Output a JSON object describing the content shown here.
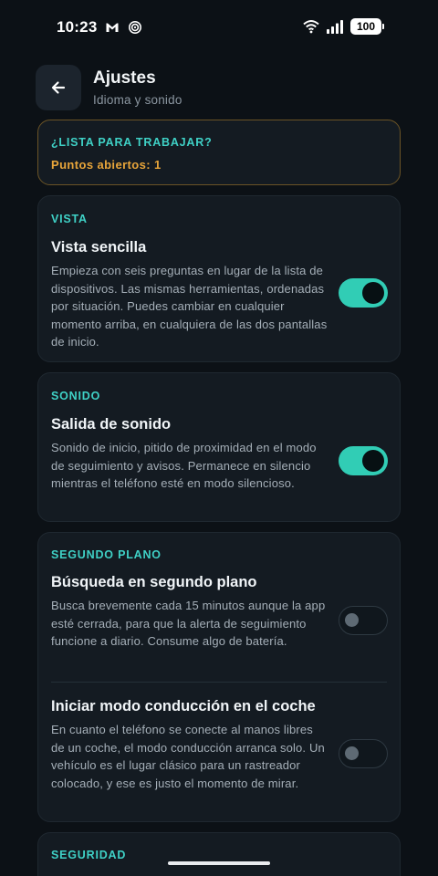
{
  "status_bar": {
    "time": "10:23",
    "battery": "100",
    "icons": [
      "gmail-icon",
      "sync-icon",
      "wifi-icon",
      "signal-icon",
      "battery-icon"
    ]
  },
  "header": {
    "title": "Ajustes",
    "subtitle": "Idioma y sonido",
    "back_icon": "arrow-left-icon"
  },
  "ready": {
    "title": "¿LISTA PARA TRABAJAR?",
    "subtitle": "Puntos abiertos: 1"
  },
  "sections": {
    "vista": {
      "title": "VISTA",
      "items": [
        {
          "title": "Vista sencilla",
          "description": "Empieza con seis preguntas en lugar de la lista de dispositivos. Las mismas herramientas, ordenadas por situación. Puedes cambiar en cualquier momento arriba, en cualquiera de las dos pantallas de inicio.",
          "enabled": true
        }
      ]
    },
    "sonido": {
      "title": "SONIDO",
      "items": [
        {
          "title": "Salida de sonido",
          "description": "Sonido de inicio, pitido de proximidad en el modo de seguimiento y avisos. Permanece en silencio mientras el teléfono esté en modo silencioso.",
          "enabled": true
        }
      ]
    },
    "segundo_plano": {
      "title": "SEGUNDO PLANO",
      "items": [
        {
          "title": "Búsqueda en segundo plano",
          "description": "Busca brevemente cada 15 minutos aunque la app esté cerrada, para que la alerta de seguimiento funcione a diario. Consume algo de batería.",
          "enabled": false
        },
        {
          "title": "Iniciar modo conducción en el coche",
          "description": "En cuanto el teléfono se conecte al manos libres de un coche, el modo conducción arranca solo. Un vehículo es el lugar clásico para un rastreador colocado, y ese es justo el momento de mirar.",
          "enabled": false
        }
      ]
    },
    "seguridad": {
      "title": "SEGURIDAD"
    }
  },
  "colors": {
    "background": "#0c1116",
    "card": "#141b22",
    "accent": "#3fd1c6",
    "toggle_on": "#31cdb5",
    "warning": "#e8a53a"
  }
}
